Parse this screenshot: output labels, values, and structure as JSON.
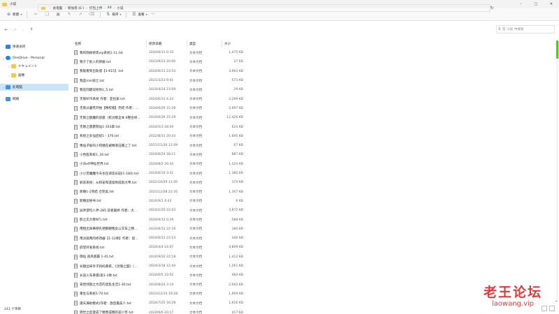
{
  "window": {
    "title": "小说"
  },
  "toolbar": {
    "new_label": "新建",
    "sort_label": "排序",
    "view_label": "查看",
    "more_label": "···"
  },
  "address": {
    "crumbs": [
      "此电脑",
      "新加卷 (E:)",
      "打包上传",
      "44",
      "小说"
    ],
    "search_placeholder": "在 小说 中搜索"
  },
  "sidebar": {
    "items": [
      {
        "label": "快速访问",
        "icon": "star-icon",
        "color": "#3b7ddd"
      },
      {
        "label": "OneDrive - Personal",
        "icon": "cloud-icon",
        "color": "#1e88e5"
      },
      {
        "label": "ドキュメント",
        "icon": "folder-icon",
        "color": "#f2c94c"
      },
      {
        "label": "画像",
        "icon": "folder-icon",
        "color": "#f2c94c"
      },
      {
        "label": "此电脑",
        "icon": "computer-icon",
        "color": "#4a90d9"
      },
      {
        "label": "网络",
        "icon": "network-icon",
        "color": "#4a90d9"
      }
    ]
  },
  "columns": {
    "name": "名称",
    "date": "修改日期",
    "type": "类型",
    "size": "大小"
  },
  "files": [
    {
      "name": "我的隐秘修炼vip系统1-11.txt",
      "date": "2024/6/11 0:33",
      "type": "文本文档",
      "size": "1,475 KB"
    },
    {
      "name": "我于了别人的新娘.txt",
      "date": "2013/9/23 10:00",
      "type": "文本文档",
      "size": "27 KB"
    },
    {
      "name": "我能看到出轨值【1-615】.txt",
      "date": "2024/6/11 23:53",
      "type": "文本文档",
      "size": "3,693 KB"
    },
    {
      "name": "我是mm骑士.txt",
      "date": "2021/3/23 9:41",
      "type": "文本文档",
      "size": "573 KB"
    },
    {
      "name": "我在同期双修你1_5.txt",
      "date": "2024/4/14 23:09",
      "type": "文本文档",
      "size": "29 KB"
    },
    {
      "name": "无限NTR系统 作者：亚拉索.txt",
      "date": "2024/6/11 4:24",
      "type": "文本文档",
      "size": "2,299 KB"
    },
    {
      "name": "无限从垂死开始【精校版】完结 作者：...",
      "date": "2024/6/29 15:28",
      "type": "文本文档",
      "size": "2,697 KB"
    },
    {
      "name": "无限之魅魔的逆袭（校对版全本 8整合修...",
      "date": "2024/6/29 15:29",
      "type": "文本文档",
      "size": "12,426 KB"
    },
    {
      "name": "无限之雷霆怒仙1-103章.txt",
      "date": "2024/5/3 18:59",
      "type": "文本文档",
      "size": "624 KB"
    },
    {
      "name": "系统之女仙后妃1 - 370.txt",
      "date": "2022/8/31 20:43",
      "type": "文本文档",
      "size": "1,695 KB"
    },
    {
      "name": "像仙子般的小阿姨在被精液征服上了.txt",
      "date": "2011/11/20 11:09",
      "type": "文本文档",
      "size": "67 KB"
    },
    {
      "name": "小色医系统1_34.txt",
      "date": "2024/6/24 18:11",
      "type": "文本文档",
      "size": "887 KB"
    },
    {
      "name": "小马xtf神仙世界.txt",
      "date": "2024/8/2 20:34",
      "type": "文本文档",
      "size": "1,324 KB"
    },
    {
      "name": "小小荒魔魔今天也在邪恶乐园(1-184).txt",
      "date": "2024/6/10 3:31",
      "type": "文本文档",
      "size": "1,380 KB"
    },
    {
      "name": "邪恶系统：从校安和遗留到成就大帝.txt",
      "date": "2022/10/29 11:45",
      "type": "文本文档",
      "size": "374 KB"
    },
    {
      "name": "新婚1-2完结 仓完美.txt",
      "date": "2021/12/28 22:35",
      "type": "文本文档",
      "size": "1,307 KB"
    },
    {
      "name": "新婚女秘书.txt",
      "date": "2024/9/1 4:43",
      "type": "文本文档",
      "size": "6 KB"
    },
    {
      "name": "异界游玩人界-285 答者最终 作者：大...",
      "date": "2024/1/20 22:03",
      "type": "文本文档",
      "size": "3,872 KB"
    },
    {
      "name": "影之实力者NTL.txt",
      "date": "2024/9/12 0:29",
      "type": "文本文档",
      "size": "588 KB"
    },
    {
      "name": "用租出海事把孔把那朝我女公交车上物...",
      "date": "2024/8/12 22:19",
      "type": "文本文档",
      "size": "180 KB"
    },
    {
      "name": "用淡吸两的修改器【1-12章】作者：提...",
      "date": "2024/6/11 23:53",
      "type": "文本文档",
      "size": "440 KB"
    },
    {
      "name": "欲望开发系统.txt",
      "date": "2024/4/4 14:07",
      "type": "文本文档",
      "size": "4,809 KB"
    },
    {
      "name": "御仙 道风底霸 1-41.txt",
      "date": "2024/9/20 22:18",
      "type": "文本文档",
      "size": "1,412 KB"
    },
    {
      "name": "长腿丝袜亲子妈妈葛筱_《灵魂之国》（...",
      "date": "2024/3/18 12:44",
      "type": "文本文档",
      "size": "1,261 KB"
    },
    {
      "name": "长途火车奇遇(第1-3章.txt",
      "date": "2024/6/5 23:52",
      "type": "文本文档",
      "size": "484 KB"
    },
    {
      "name": "拿捏绿丽之为恋的混乱生活1-30.txt",
      "date": "2024/8/24 3:14",
      "type": "文本文档",
      "size": "2,643 KB"
    },
    {
      "name": "重生与系统1-70.txt",
      "date": "2023/12/14 19:28",
      "type": "文本文档",
      "size": "1,909 KB"
    },
    {
      "name": "諸天满射模式(作者：放后最美人.txt",
      "date": "2024/7/25 16:28",
      "type": "文本文档",
      "size": "1,616 KB"
    },
    {
      "name": "转世之后变成了精而成精的美少年.txt",
      "date": "2024/9/6 20:17",
      "type": "文本文档",
      "size": "417 KB"
    }
  ],
  "status": {
    "count": "141 个项目"
  },
  "watermark": {
    "line1": "老王论坛",
    "line2": "laowang.vip"
  }
}
